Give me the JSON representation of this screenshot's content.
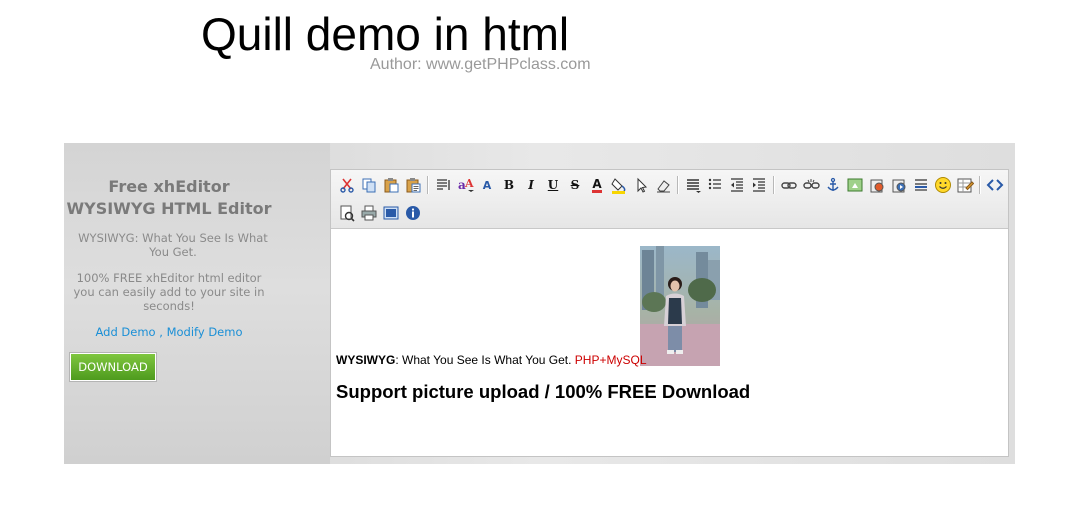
{
  "page": {
    "title": "Quill demo in html",
    "author": "Author: www.getPHPclass.com"
  },
  "sidebar": {
    "heading_line1": "Free xhEditor",
    "heading_line2": "WYSIWYG HTML Editor",
    "tagline": "WYSIWYG: What You See Is What You Get.",
    "description": "100% FREE xhEditor html editor you can easily add to your site in seconds!",
    "link_add": "Add Demo",
    "link_separator": " , ",
    "link_modify": "Modify Demo",
    "download_label": "DOWNLOAD"
  },
  "toolbar": {
    "row1": [
      "cut-icon",
      "copy-icon",
      "paste-icon",
      "paste-text-icon",
      "|",
      "block-format-icon",
      "font-family-icon",
      "font-size-icon",
      "bold-icon",
      "italic-icon",
      "underline-icon",
      "strikethrough-icon",
      "font-color-icon",
      "background-color-icon",
      "select-all-icon",
      "remove-format-icon",
      "|",
      "align-icon",
      "list-icon",
      "outdent-icon",
      "indent-icon",
      "|",
      "link-icon",
      "unlink-icon",
      "anchor-icon",
      "image-icon",
      "flash-icon",
      "media-icon",
      "horizontal-rule-icon",
      "emoticon-icon",
      "table-icon",
      "|",
      "source-icon"
    ],
    "row2": [
      "preview-icon",
      "print-icon",
      "fullscreen-icon",
      "about-icon"
    ],
    "letters": {
      "bold-icon": "B",
      "italic-icon": "I",
      "underline-icon": "U",
      "strikethrough-icon": "S",
      "font-color-icon": "A",
      "font-size-icon": "A"
    }
  },
  "content": {
    "wysiwyg_bold": "WYSIWYG",
    "wysiwyg_rest": ": What You See Is What You Get. ",
    "php_link": "PHP+MySQL",
    "heading": "Support picture upload / 100% FREE Download"
  },
  "colors": {
    "accent_link": "#1a8fd6",
    "download_green": "#5aa826",
    "php_red": "#cc0000"
  }
}
